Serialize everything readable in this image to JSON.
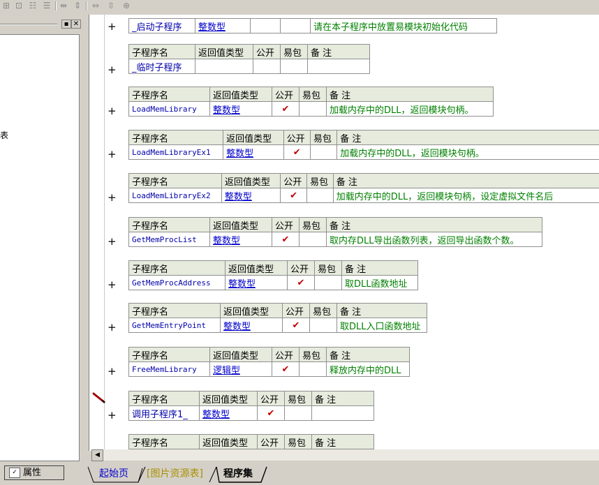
{
  "toolbar": {
    "icons": [
      "table-insert-icon",
      "table-cell-icon",
      "table-row-icon",
      "table-col-icon",
      "align-h-icon",
      "align-v-icon",
      "fit-width-icon",
      "fit-height-icon",
      "fit-all-icon"
    ]
  },
  "left_panel": {
    "tree_fragment": "表",
    "properties_label": "属性"
  },
  "headers": {
    "name": "子程序名",
    "return_type": "返回值类型",
    "public": "公开",
    "easy_pack": "易包",
    "note": "备 注"
  },
  "subprograms": [
    {
      "name": "_启动子程序",
      "type": "整数型",
      "public": "",
      "note": "请在本子程序中放置易模块初始化代码"
    },
    {
      "name": "_临时子程序",
      "type": "",
      "public": "",
      "note": ""
    },
    {
      "name": "LoadMemLibrary",
      "type": "整数型",
      "public": "✔",
      "note": "加载内存中的DLL，返回模块句柄。"
    },
    {
      "name": "LoadMemLibraryEx1",
      "type": "整数型",
      "public": "✔",
      "note": "加载内存中的DLL，返回模块句柄。"
    },
    {
      "name": "LoadMemLibraryEx2",
      "type": "整数型",
      "public": "✔",
      "note": "加载内存中的DLL，返回模块句柄，设定虚拟文件名后"
    },
    {
      "name": "GetMemProcList",
      "type": "整数型",
      "public": "✔",
      "note": "取内存DLL导出函数列表，返回导出函数个数。"
    },
    {
      "name": "GetMemProcAddress",
      "type": "整数型",
      "public": "✔",
      "note": "取DLL函数地址"
    },
    {
      "name": "GetMemEntryPoint",
      "type": "整数型",
      "public": "✔",
      "note": "取DLL入口函数地址"
    },
    {
      "name": "FreeMemLibrary",
      "type": "逻辑型",
      "public": "✔",
      "note": "释放内存中的DLL"
    },
    {
      "name": "调用子程序1_",
      "type": "整数型",
      "public": "✔",
      "note": ""
    }
  ],
  "tabs": [
    {
      "label": "起始页"
    },
    {
      "label": "[图片资源表]"
    },
    {
      "label": "程序集"
    }
  ],
  "colors": {
    "header_bg": "#e6ebdd",
    "name_blue": "#0000aa",
    "note_green": "#008000",
    "check_red": "#c00000"
  }
}
